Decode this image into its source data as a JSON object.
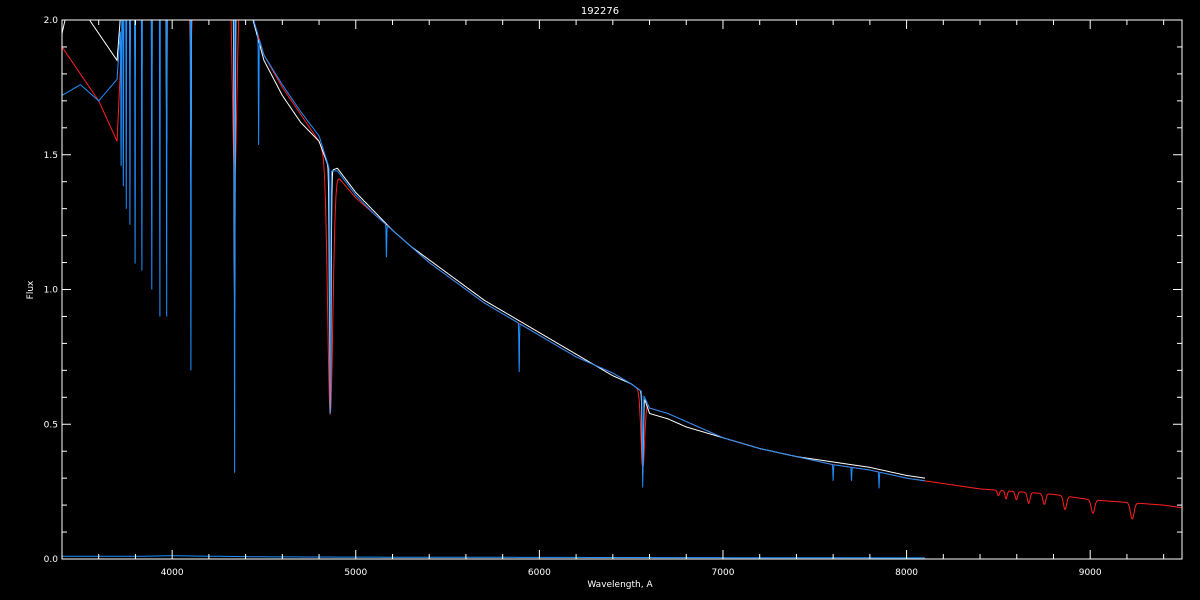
{
  "chart_data": {
    "type": "line",
    "title": "192276",
    "xlabel": "Wavelength, A",
    "ylabel": "Flux",
    "xlim": [
      3400,
      9500
    ],
    "ylim": [
      0.0,
      2.0
    ],
    "xticks": [
      4000,
      5000,
      6000,
      7000,
      8000,
      9000
    ],
    "xtick_labels": [
      "4000",
      "5000",
      "6000",
      "7000",
      "8000",
      "9000"
    ],
    "yticks": [
      0.0,
      0.5,
      1.0,
      1.5,
      2.0
    ],
    "ytick_labels": [
      "0.0",
      "0.5",
      "1.0",
      "1.5",
      "2.0"
    ],
    "grid": false,
    "background": "#000000",
    "series": [
      {
        "color": "#ff2020",
        "continuum": [
          [
            3400,
            1.9
          ],
          [
            3500,
            1.8
          ],
          [
            3600,
            1.7
          ],
          [
            3700,
            1.55
          ],
          [
            3750,
            2.3
          ],
          [
            3850,
            2.5
          ],
          [
            4000,
            2.5
          ],
          [
            4200,
            2.5
          ],
          [
            4400,
            2.1
          ],
          [
            4500,
            1.87
          ],
          [
            4600,
            1.75
          ],
          [
            4700,
            1.65
          ],
          [
            4800,
            1.55
          ],
          [
            4860,
            1.44
          ],
          [
            4900,
            1.42
          ],
          [
            5000,
            1.34
          ],
          [
            5100,
            1.28
          ],
          [
            5200,
            1.22
          ],
          [
            5300,
            1.16
          ],
          [
            5400,
            1.1
          ],
          [
            5500,
            1.05
          ],
          [
            5600,
            1.0
          ],
          [
            5700,
            0.95
          ],
          [
            5800,
            0.91
          ],
          [
            5900,
            0.87
          ],
          [
            6000,
            0.83
          ],
          [
            6100,
            0.79
          ],
          [
            6200,
            0.75
          ],
          [
            6300,
            0.72
          ],
          [
            6400,
            0.69
          ],
          [
            6500,
            0.65
          ],
          [
            6560,
            0.62
          ],
          [
            6600,
            0.56
          ],
          [
            6700,
            0.54
          ],
          [
            6800,
            0.51
          ],
          [
            6900,
            0.48
          ],
          [
            7000,
            0.45
          ],
          [
            7200,
            0.41
          ],
          [
            7400,
            0.38
          ],
          [
            7600,
            0.35
          ],
          [
            7800,
            0.33
          ],
          [
            8000,
            0.3
          ],
          [
            8100,
            0.29
          ],
          [
            8200,
            0.28
          ],
          [
            8400,
            0.26
          ],
          [
            8600,
            0.25
          ],
          [
            8800,
            0.24
          ],
          [
            9000,
            0.22
          ],
          [
            9200,
            0.21
          ],
          [
            9400,
            0.2
          ],
          [
            9500,
            0.19
          ]
        ],
        "absorption_lines": [
          [
            3770,
            0.35,
            6
          ],
          [
            3798,
            0.3,
            6
          ],
          [
            3835,
            0.3,
            7
          ],
          [
            3889,
            0.35,
            8
          ],
          [
            3970,
            0.45,
            10
          ],
          [
            4102,
            0.6,
            14
          ],
          [
            4340,
            0.8,
            18
          ],
          [
            4861,
            0.9,
            20
          ],
          [
            6563,
            0.28,
            14
          ],
          [
            8500,
            0.02,
            8
          ],
          [
            8542,
            0.03,
            8
          ],
          [
            8598,
            0.03,
            9
          ],
          [
            8665,
            0.04,
            10
          ],
          [
            8750,
            0.04,
            11
          ],
          [
            8863,
            0.05,
            12
          ],
          [
            9015,
            0.05,
            13
          ],
          [
            9229,
            0.06,
            14
          ]
        ]
      },
      {
        "color": "#ffffff",
        "continuum": [
          [
            3400,
            1.95
          ],
          [
            3450,
            2.1
          ],
          [
            3500,
            2.05
          ],
          [
            3600,
            1.95
          ],
          [
            3700,
            1.85
          ],
          [
            3750,
            2.3
          ],
          [
            3850,
            2.5
          ],
          [
            4000,
            2.5
          ],
          [
            4200,
            2.5
          ],
          [
            4400,
            2.1
          ],
          [
            4500,
            1.85
          ],
          [
            4600,
            1.72
          ],
          [
            4700,
            1.62
          ],
          [
            4800,
            1.55
          ],
          [
            4860,
            1.44
          ],
          [
            4900,
            1.45
          ],
          [
            5000,
            1.36
          ],
          [
            5100,
            1.29
          ],
          [
            5200,
            1.22
          ],
          [
            5300,
            1.16
          ],
          [
            5400,
            1.11
          ],
          [
            5500,
            1.06
          ],
          [
            5600,
            1.01
          ],
          [
            5700,
            0.96
          ],
          [
            5800,
            0.92
          ],
          [
            5900,
            0.88
          ],
          [
            6000,
            0.84
          ],
          [
            6100,
            0.8
          ],
          [
            6200,
            0.76
          ],
          [
            6300,
            0.72
          ],
          [
            6400,
            0.68
          ],
          [
            6500,
            0.65
          ],
          [
            6560,
            0.62
          ],
          [
            6600,
            0.54
          ],
          [
            6700,
            0.52
          ],
          [
            6800,
            0.49
          ],
          [
            6900,
            0.47
          ],
          [
            7000,
            0.45
          ],
          [
            7200,
            0.41
          ],
          [
            7400,
            0.38
          ],
          [
            7600,
            0.36
          ],
          [
            7800,
            0.34
          ],
          [
            8000,
            0.31
          ],
          [
            8100,
            0.3
          ]
        ],
        "absorption_lines": [
          [
            3770,
            0.55,
            3
          ],
          [
            3798,
            0.6,
            3
          ],
          [
            3835,
            0.7,
            3
          ],
          [
            3889,
            0.8,
            3
          ],
          [
            3970,
            0.95,
            4
          ],
          [
            4102,
            1.1,
            4
          ],
          [
            4340,
            1.3,
            5
          ],
          [
            4861,
            0.9,
            6
          ],
          [
            6563,
            0.3,
            5
          ]
        ]
      },
      {
        "color": "#1e90ff",
        "continuum": [
          [
            3400,
            1.72
          ],
          [
            3500,
            1.76
          ],
          [
            3600,
            1.7
          ],
          [
            3700,
            1.78
          ],
          [
            3750,
            2.3
          ],
          [
            3850,
            2.5
          ],
          [
            4000,
            2.5
          ],
          [
            4200,
            2.5
          ],
          [
            4400,
            2.1
          ],
          [
            4500,
            1.87
          ],
          [
            4600,
            1.76
          ],
          [
            4700,
            1.66
          ],
          [
            4800,
            1.57
          ],
          [
            4860,
            1.44
          ],
          [
            4900,
            1.44
          ],
          [
            5000,
            1.35
          ],
          [
            5100,
            1.28
          ],
          [
            5200,
            1.22
          ],
          [
            5300,
            1.16
          ],
          [
            5400,
            1.1
          ],
          [
            5500,
            1.05
          ],
          [
            5600,
            1.0
          ],
          [
            5700,
            0.95
          ],
          [
            5800,
            0.91
          ],
          [
            5900,
            0.87
          ],
          [
            6000,
            0.83
          ],
          [
            6100,
            0.79
          ],
          [
            6200,
            0.75
          ],
          [
            6300,
            0.72
          ],
          [
            6400,
            0.69
          ],
          [
            6500,
            0.65
          ],
          [
            6560,
            0.62
          ],
          [
            6600,
            0.56
          ],
          [
            6700,
            0.54
          ],
          [
            6800,
            0.51
          ],
          [
            6900,
            0.48
          ],
          [
            7000,
            0.45
          ],
          [
            7200,
            0.41
          ],
          [
            7400,
            0.38
          ],
          [
            7600,
            0.35
          ],
          [
            7800,
            0.33
          ],
          [
            8000,
            0.3
          ],
          [
            8100,
            0.29
          ]
        ],
        "absorption_lines": [
          [
            3722,
            0.55,
            2
          ],
          [
            3734,
            0.75,
            2
          ],
          [
            3750,
            1.0,
            2
          ],
          [
            3770,
            1.1,
            2
          ],
          [
            3798,
            1.3,
            2
          ],
          [
            3835,
            1.4,
            2
          ],
          [
            3889,
            1.5,
            2
          ],
          [
            3933,
            1.6,
            2
          ],
          [
            3970,
            1.6,
            2
          ],
          [
            4102,
            1.8,
            2
          ],
          [
            4340,
            1.9,
            2
          ],
          [
            4471,
            0.4,
            2
          ],
          [
            4861,
            0.9,
            3
          ],
          [
            5167,
            0.12,
            2
          ],
          [
            5890,
            0.18,
            2
          ],
          [
            6563,
            0.35,
            3
          ],
          [
            7600,
            0.06,
            2
          ],
          [
            7700,
            0.05,
            2
          ],
          [
            7850,
            0.06,
            2
          ]
        ]
      },
      {
        "color": "#1e90ff",
        "continuum": [
          [
            3400,
            0.01
          ],
          [
            3800,
            0.01
          ],
          [
            4000,
            0.012
          ],
          [
            4500,
            0.008
          ],
          [
            5000,
            0.007
          ],
          [
            6000,
            0.006
          ],
          [
            7000,
            0.005
          ],
          [
            8100,
            0.004
          ]
        ],
        "absorption_lines": []
      }
    ]
  }
}
